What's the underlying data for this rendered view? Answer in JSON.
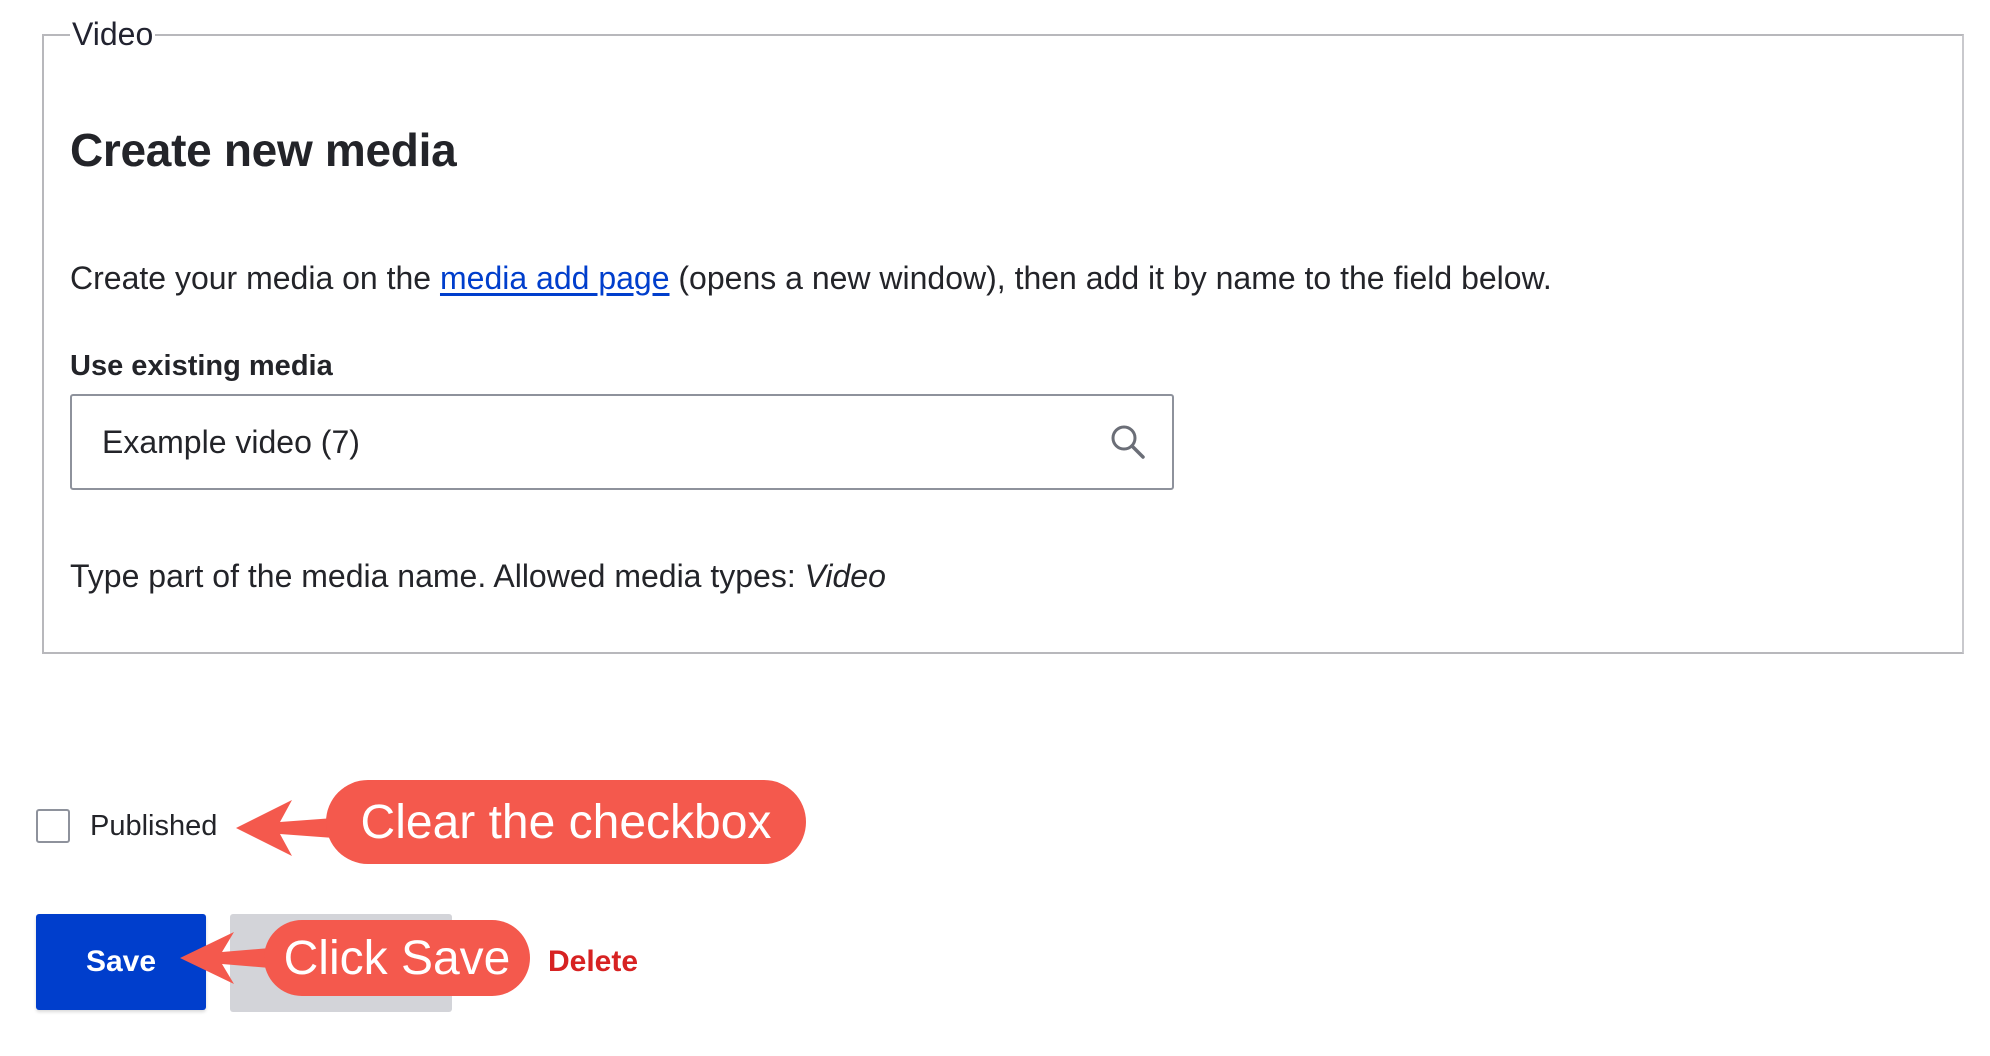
{
  "fieldset": {
    "legend": "Video",
    "heading": "Create new media",
    "description": {
      "before": "Create your media on the ",
      "link": "media add page",
      "after": " (opens a new window), then add it by name to the field below."
    },
    "field_label": "Use existing media",
    "input_value": "Example video (7)",
    "help_text_prefix": "Type part of the media name. Allowed media types: ",
    "help_text_type": "Video"
  },
  "published": {
    "label": "Published",
    "checked": false
  },
  "actions": {
    "save_label": "Save",
    "delete_label": "Delete"
  },
  "annotations": {
    "checkbox_callout": "Clear the checkbox",
    "save_callout": "Click Save",
    "color": "#f4594d"
  },
  "colors": {
    "primary_button": "#003ecc",
    "link": "#003ecc",
    "danger": "#d72222"
  }
}
